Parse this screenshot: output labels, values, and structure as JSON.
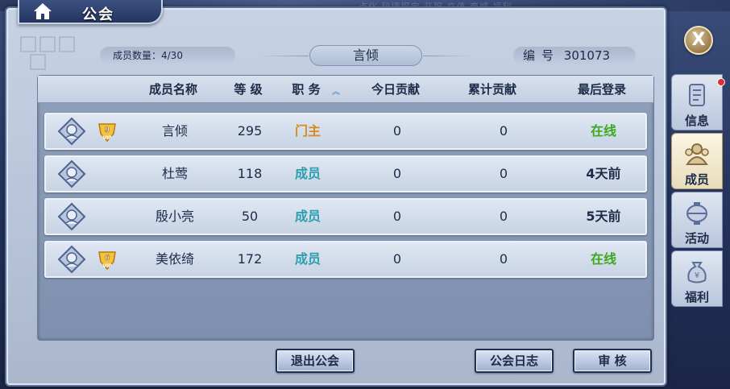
{
  "background": {
    "ghost_menu": "点化   秘境探宝   开服   充值   商城   福利"
  },
  "header": {
    "title": "公会"
  },
  "info_bar": {
    "member_count": "成员数量：4/30",
    "guild_name": "言倾",
    "id_label": "编号",
    "id_value": "301073"
  },
  "table": {
    "columns": [
      "成员名称",
      "等 级",
      "职 务",
      "今日贡献",
      "累计贡献",
      "最后登录"
    ],
    "sort_icon": "sort-toggle-icon",
    "rows": [
      {
        "name": "言倾",
        "level": "295",
        "role": "门主",
        "today": "0",
        "total": "0",
        "last_login": "在线",
        "vip": "9",
        "role_color": "#d98a1a",
        "login_color": "#3fa820"
      },
      {
        "name": "杜莺",
        "level": "118",
        "role": "成员",
        "today": "0",
        "total": "0",
        "last_login": "4天前",
        "vip": "",
        "role_color": "#2a9fb0",
        "login_color": "#1d2b48"
      },
      {
        "name": "殷小亮",
        "level": "50",
        "role": "成员",
        "today": "0",
        "total": "0",
        "last_login": "5天前",
        "vip": "",
        "role_color": "#2a9fb0",
        "login_color": "#1d2b48"
      },
      {
        "name": "美依绮",
        "level": "172",
        "role": "成员",
        "today": "0",
        "total": "0",
        "last_login": "在线",
        "vip": "6",
        "role_color": "#2a9fb0",
        "login_color": "#3fa820"
      }
    ]
  },
  "buttons": {
    "leave": "退出公会",
    "log": "公会日志",
    "review": "审  核",
    "close": "X"
  },
  "side_tabs": [
    {
      "label": "信息",
      "icon": "scroll-info-icon",
      "badge": true
    },
    {
      "label": "成员",
      "icon": "members-icon",
      "active": true
    },
    {
      "label": "活动",
      "icon": "activity-lantern-icon"
    },
    {
      "label": "福利",
      "icon": "money-bag-icon"
    }
  ]
}
